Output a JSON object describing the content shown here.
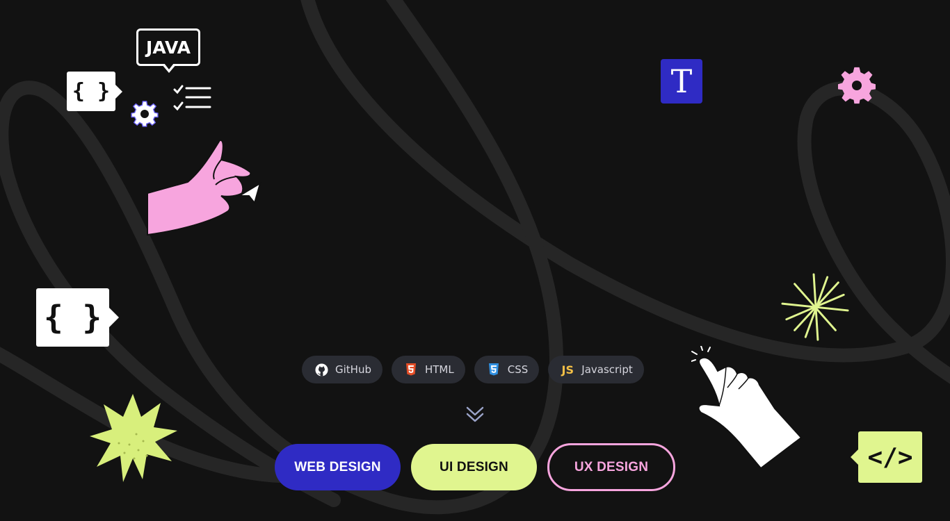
{
  "decorations": {
    "brace_symbol": "{ }",
    "java_label": "JAVA",
    "t_tile_letter": "T",
    "code_tag": "</>",
    "colors": {
      "background": "#121212",
      "primary_blue": "#2f2bc4",
      "lime": "#e0f58f",
      "pink": "#f7a5de",
      "chip_bg": "#2a2c33"
    }
  },
  "chips": [
    {
      "label": "GitHub",
      "icon": "github-icon"
    },
    {
      "label": "HTML",
      "icon": "html5-icon"
    },
    {
      "label": "CSS",
      "icon": "css3-icon"
    },
    {
      "label": "Javascript",
      "icon": "js-icon",
      "mark": "JS"
    }
  ],
  "scroll_cue": {
    "icon": "double-chevron-down-icon"
  },
  "buttons": {
    "web_design": "WEB DESIGN",
    "ui_design": "UI DESIGN",
    "ux_design": "UX DESIGN"
  }
}
